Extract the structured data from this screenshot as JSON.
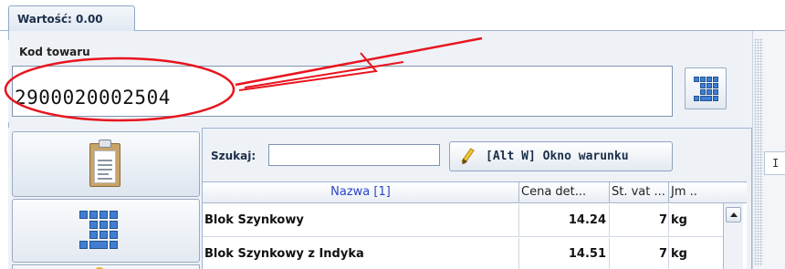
{
  "tab": {
    "label": "Wartość: 0.00"
  },
  "kod": {
    "label": "Kod towaru",
    "value": "2900020002504"
  },
  "search": {
    "label": "Szukaj:",
    "value": ""
  },
  "condition_button": {
    "label": "[Alt W] Okno warunku"
  },
  "table": {
    "columns": [
      "Nazwa [1]",
      "Cena det...",
      "St. vat ...",
      "Jm .."
    ],
    "rows": [
      {
        "name": "Blok Szynkowy",
        "price": "14.24",
        "vat": "7",
        "unit": "kg"
      },
      {
        "name": "Blok Szynkowy z Indyka",
        "price": "14.51",
        "vat": "7",
        "unit": "kg"
      }
    ]
  },
  "right_panel": {
    "text": "I"
  },
  "colors": {
    "annotation": "#e8141e",
    "header_link": "#2a45c9",
    "keypad": "#3f7ed2"
  }
}
